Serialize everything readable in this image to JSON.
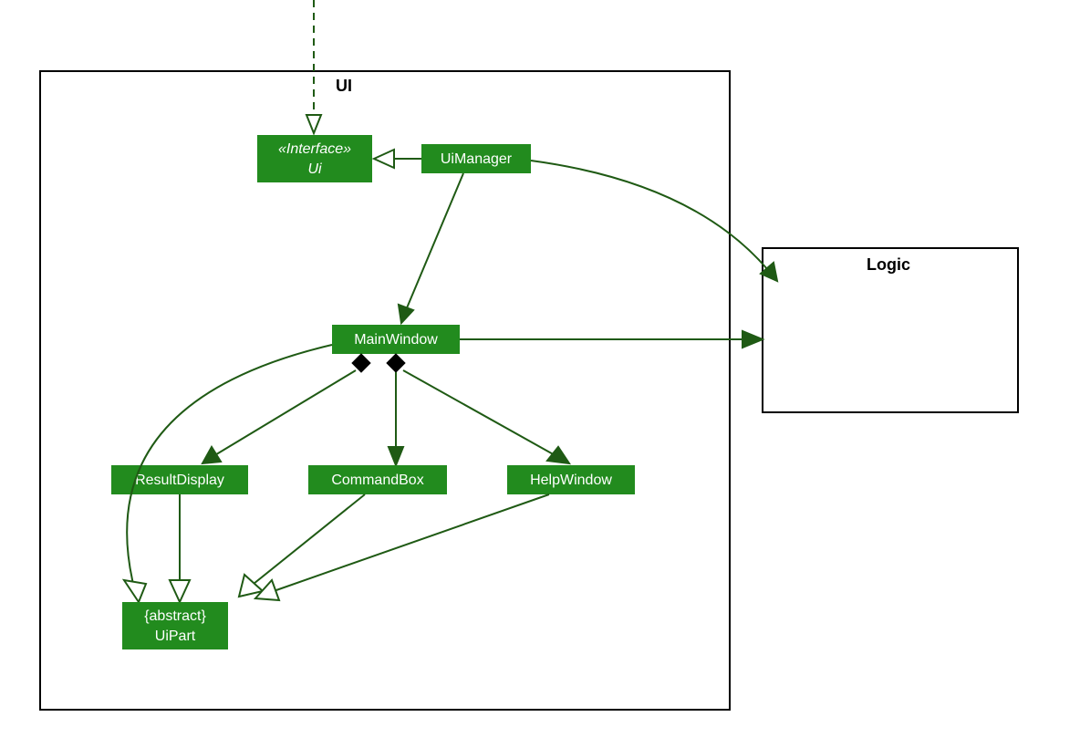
{
  "packages": {
    "ui": {
      "label": "UI"
    },
    "logic": {
      "label": "Logic"
    }
  },
  "nodes": {
    "ui_interface": {
      "stereo": "«Interface»",
      "name": "Ui"
    },
    "uimanager": {
      "name": "UiManager"
    },
    "mainwindow": {
      "name": "MainWindow"
    },
    "resultdisplay": {
      "name": "ResultDisplay"
    },
    "commandbox": {
      "name": "CommandBox"
    },
    "helpwindow": {
      "name": "HelpWindow"
    },
    "uipart": {
      "constraint": "{abstract}",
      "name": "UiPart"
    }
  },
  "colors": {
    "nodeFill": "#228B1E",
    "edge": "#1F5A14"
  },
  "edges": [
    {
      "from": "external",
      "to": "ui_interface",
      "type": "dependency-dashed"
    },
    {
      "from": "uimanager",
      "to": "ui_interface",
      "type": "realization"
    },
    {
      "from": "uimanager",
      "to": "mainwindow",
      "type": "association"
    },
    {
      "from": "uimanager",
      "to": "logic",
      "type": "association-curve"
    },
    {
      "from": "mainwindow",
      "to": "logic",
      "type": "association"
    },
    {
      "from": "mainwindow",
      "to": "resultdisplay",
      "type": "association-diamond"
    },
    {
      "from": "mainwindow",
      "to": "commandbox",
      "type": "association-diamond"
    },
    {
      "from": "mainwindow",
      "to": "helpwindow",
      "type": "association-diamond"
    },
    {
      "from": "mainwindow",
      "to": "uipart",
      "type": "generalization-curve"
    },
    {
      "from": "resultdisplay",
      "to": "uipart",
      "type": "generalization"
    },
    {
      "from": "commandbox",
      "to": "uipart",
      "type": "generalization"
    },
    {
      "from": "helpwindow",
      "to": "uipart",
      "type": "generalization"
    }
  ]
}
